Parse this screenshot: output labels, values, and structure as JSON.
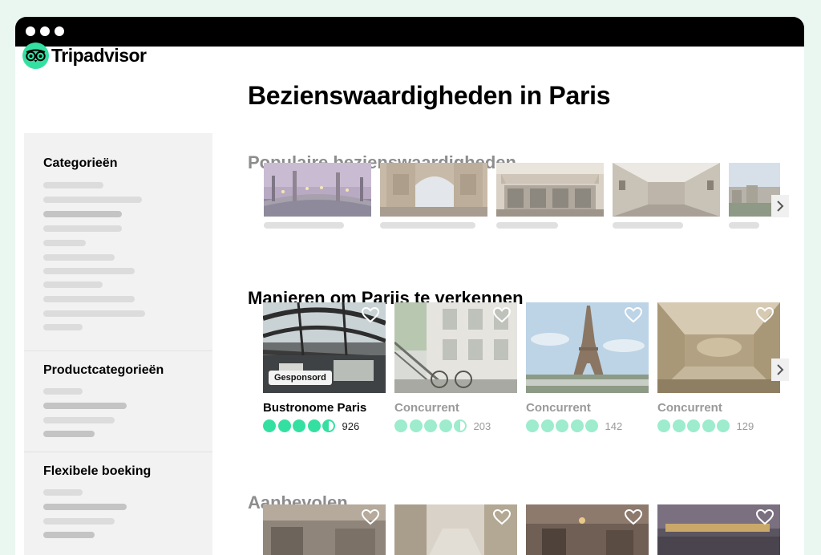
{
  "brand": {
    "name": "Tripadvisor",
    "color": "#34e0a1"
  },
  "page": {
    "title": "Bezienswaardigheden in Paris"
  },
  "sidebar": {
    "sections": [
      {
        "title": "Categorieën"
      },
      {
        "title": "Productcategorieën"
      },
      {
        "title": "Flexibele boeking"
      }
    ]
  },
  "popular": {
    "title": "Populaire bezienswaardigheden",
    "items": [
      {
        "image": "pont-alexandre-iii-bridge"
      },
      {
        "image": "arc-de-triomphe"
      },
      {
        "image": "paris-cafe-terrace"
      },
      {
        "image": "louvre-gallery"
      },
      {
        "image": "paris-rooftops"
      }
    ]
  },
  "explore": {
    "title": "Manieren om Parijs te verkennen",
    "items": [
      {
        "title": "Bustronome Paris",
        "badge": "Gesponsord",
        "count": "926",
        "rating": 4.5,
        "image": "bus-glass-roof"
      },
      {
        "title": "Concurrent",
        "count": "203",
        "rating": 4.5,
        "image": "bikes-parisian-building"
      },
      {
        "title": "Concurrent",
        "count": "142",
        "rating": 5,
        "image": "eiffel-tower"
      },
      {
        "title": "Concurrent",
        "count": "129",
        "rating": 5,
        "image": "ornate-ceiling"
      }
    ]
  },
  "recommended": {
    "title": "Aanbevolen"
  },
  "icons": {
    "heart": "heart-icon",
    "next": "chevron-right-icon",
    "owl": "owl-eyes-icon"
  }
}
